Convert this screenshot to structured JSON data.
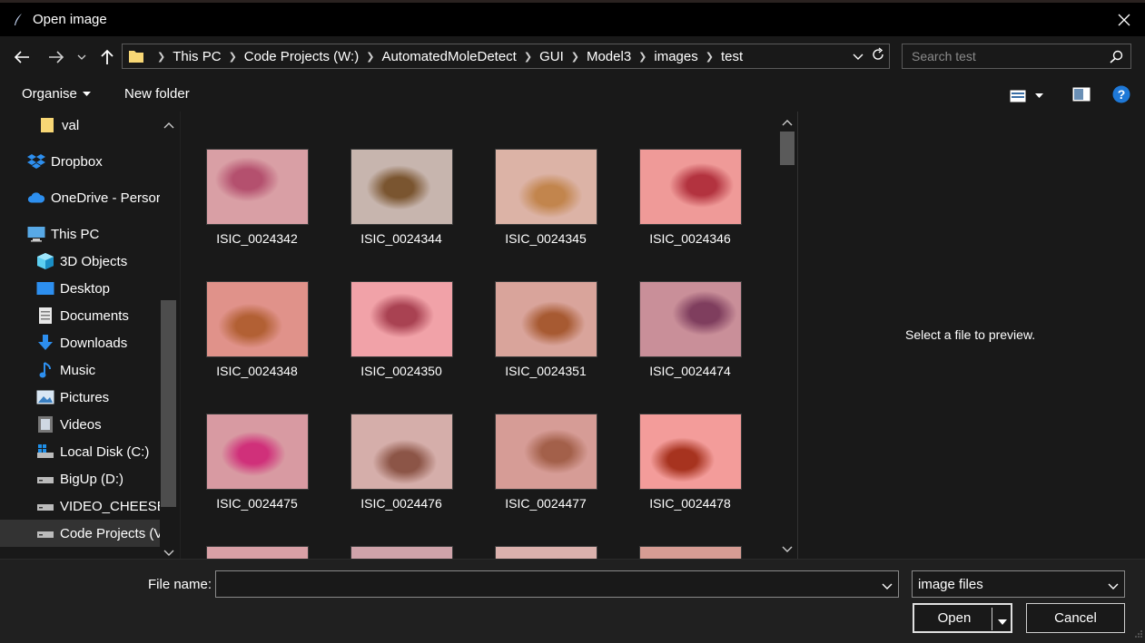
{
  "window": {
    "title": "Open image"
  },
  "address": {
    "crumbs": [
      "This PC",
      "Code Projects (W:)",
      "AutomatedMoleDetect",
      "GUI",
      "Model3",
      "images",
      "test"
    ]
  },
  "search": {
    "placeholder": "Search test"
  },
  "commands": {
    "organise": "Organise",
    "new_folder": "New folder"
  },
  "sidebar": {
    "items": [
      {
        "label": "val",
        "icon": "folder-icon"
      },
      {
        "label": "Dropbox",
        "icon": "dropbox-icon"
      },
      {
        "label": "OneDrive - Persor",
        "icon": "onedrive-icon"
      },
      {
        "label": "This PC",
        "icon": "pc-icon"
      },
      {
        "label": "3D Objects",
        "icon": "3d-objects-icon"
      },
      {
        "label": "Desktop",
        "icon": "desktop-icon"
      },
      {
        "label": "Documents",
        "icon": "documents-icon"
      },
      {
        "label": "Downloads",
        "icon": "downloads-icon"
      },
      {
        "label": "Music",
        "icon": "music-icon"
      },
      {
        "label": "Pictures",
        "icon": "pictures-icon"
      },
      {
        "label": "Videos",
        "icon": "videos-icon"
      },
      {
        "label": "Local Disk (C:)",
        "icon": "local-disk-icon"
      },
      {
        "label": "BigUp (D:)",
        "icon": "drive-icon"
      },
      {
        "label": "VIDEO_CHEESE (",
        "icon": "drive-icon"
      },
      {
        "label": "Code Projects (V",
        "icon": "drive-icon",
        "selected": true
      }
    ]
  },
  "files": [
    {
      "name": "ISIC_0024342",
      "skin": "#d99fa5",
      "lesion": "#b4506e"
    },
    {
      "name": "ISIC_0024344",
      "skin": "#c7b5ae",
      "lesion": "#7a5530"
    },
    {
      "name": "ISIC_0024345",
      "skin": "#dcb3a6",
      "lesion": "#c2854d"
    },
    {
      "name": "ISIC_0024346",
      "skin": "#ef9a98",
      "lesion": "#b3333f"
    },
    {
      "name": "ISIC_0024348",
      "skin": "#e0928a",
      "lesion": "#b26034"
    },
    {
      "name": "ISIC_0024350",
      "skin": "#f1a2a8",
      "lesion": "#a94252"
    },
    {
      "name": "ISIC_0024351",
      "skin": "#d9a49b",
      "lesion": "#a75a32"
    },
    {
      "name": "ISIC_0024474",
      "skin": "#c98f99",
      "lesion": "#7f3e5e"
    },
    {
      "name": "ISIC_0024475",
      "skin": "#d89aa2",
      "lesion": "#d0307a"
    },
    {
      "name": "ISIC_0024476",
      "skin": "#d5aeaa",
      "lesion": "#8c5547"
    },
    {
      "name": "ISIC_0024477",
      "skin": "#d69c96",
      "lesion": "#a3604a"
    },
    {
      "name": "ISIC_0024478",
      "skin": "#f39c9a",
      "lesion": "#a7331f"
    },
    {
      "name": "",
      "skin": "#d9a0a6",
      "lesion": "#c98c95"
    },
    {
      "name": "",
      "skin": "#cfa3aa",
      "lesion": "#a66c7a"
    },
    {
      "name": "",
      "skin": "#dbb1ad",
      "lesion": "#c59a95"
    },
    {
      "name": "",
      "skin": "#d79c94",
      "lesion": "#9b4a39"
    }
  ],
  "preview": {
    "text": "Select a file to preview."
  },
  "footer": {
    "file_name_label": "File name:",
    "file_name_value": "",
    "file_type": "image files",
    "open_label": "Open",
    "cancel_label": "Cancel"
  },
  "colors": {
    "accent_blue": "#1e78d7",
    "folder_yellow": "#f8d775"
  }
}
